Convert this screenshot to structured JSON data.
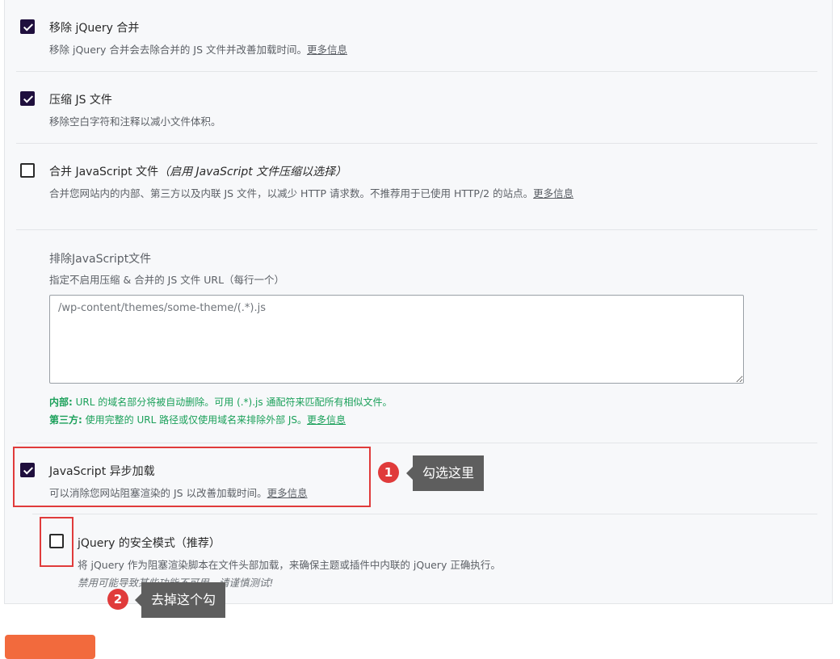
{
  "options": {
    "remove_jquery_migrate": {
      "title": "移除 jQuery 合并",
      "desc": "移除 jQuery 合并会去除合并的 JS 文件并改善加载时间。",
      "link": "更多信息",
      "checked": true
    },
    "minify_js": {
      "title": "压缩 JS 文件",
      "desc": "移除空白字符和注释以减小文件体积。",
      "checked": true
    },
    "combine_js": {
      "title": "合并 JavaScript 文件",
      "note": "（启用 JavaScript 文件压缩以选择）",
      "desc": "合并您网站内的内部、第三方以及内联 JS 文件，以减少 HTTP 请求数。不推荐用于已使用 HTTP/2 的站点。",
      "link": "更多信息",
      "checked": false
    },
    "exclude_js": {
      "title": "排除JavaScript文件",
      "desc": "指定不启用压缩 & 合并的 JS 文件 URL（每行一个）",
      "placeholder": "/wp-content/themes/some-theme/(.*).js",
      "help_internal_label": "内部:",
      "help_internal_text": " URL 的域名部分将被自动删除。可用 (.*).js 通配符来匹配所有相似文件。",
      "help_third_label": "第三方:",
      "help_third_text": " 使用完整的 URL 路径或仅使用域名来排除外部 JS。",
      "help_link": "更多信息"
    },
    "defer_js": {
      "title": "JavaScript 异步加载",
      "desc": "可以消除您网站阻塞渲染的 JS 以改善加载时间。",
      "link": "更多信息",
      "checked": true
    },
    "jquery_safe_mode": {
      "title": "jQuery 的安全模式（推荐）",
      "desc": "将 jQuery 作为阻塞渲染脚本在文件头部加载，来确保主题或插件中内联的 jQuery 正确执行。",
      "warning": "禁用可能导致某些功能不可用，请谨慎测试!",
      "checked": false
    }
  },
  "annotations": {
    "step1_number": "1",
    "step1_text": "勾选这里",
    "step2_number": "2",
    "step2_text": "去掉这个勾",
    "highlight_color": "#e03b3b"
  },
  "colors": {
    "checkbox_checked": "#1f0f3d",
    "help_green": "#1ba05a",
    "save_button": "#f26a3d"
  }
}
